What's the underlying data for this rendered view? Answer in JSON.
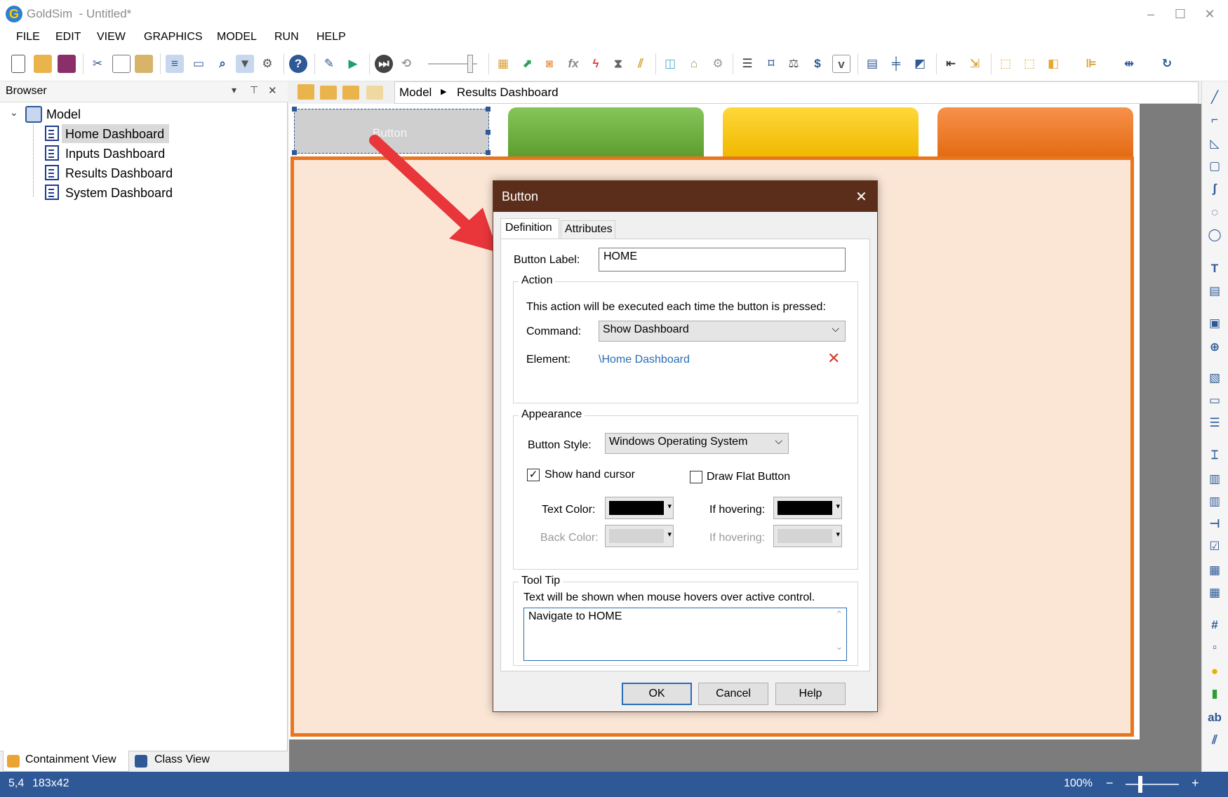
{
  "window": {
    "title": "GoldSim  - Untitled*",
    "logo": "G",
    "minimize": "–",
    "maximize": "☐",
    "close": "✕"
  },
  "menu": [
    "FILE",
    "EDIT",
    "VIEW",
    "GRAPHICS",
    "MODEL",
    "RUN",
    "HELP"
  ],
  "browser": {
    "title": "Browser",
    "root": "Model",
    "items": [
      "Home Dashboard",
      "Inputs Dashboard",
      "Results Dashboard",
      "System Dashboard"
    ],
    "tabs": [
      "Containment View",
      "Class View"
    ]
  },
  "breadcrumb": {
    "root": "Model",
    "current": "Results Dashboard"
  },
  "canvas": {
    "button_text": "Button",
    "colors": {
      "green": "#6aaa3a",
      "yellow": "#f5c000",
      "orange": "#ef7a1a",
      "panel_fill": "#fbe6d6",
      "panel_border": "#e8761e"
    }
  },
  "dialog": {
    "title": "Button",
    "tabs": [
      "Definition",
      "Attributes"
    ],
    "button_label": {
      "label": "Button Label:",
      "value": "HOME"
    },
    "action": {
      "title": "Action",
      "description": "This action will be executed each time the button is pressed:",
      "command_label": "Command:",
      "command_value": "Show Dashboard",
      "element_label": "Element:",
      "element_value": "\\Home Dashboard",
      "remove_icon": "✕"
    },
    "appearance": {
      "title": "Appearance",
      "style_label": "Button Style:",
      "style_value": "Windows Operating System",
      "hand_cursor_label": "Show hand cursor",
      "hand_cursor_checked": true,
      "flat_label": "Draw Flat Button",
      "flat_checked": false,
      "text_color_label": "Text Color:",
      "text_hover_label": "If hovering:",
      "back_color_label": "Back Color:",
      "back_hover_label": "If hovering:",
      "text_color": "#000000",
      "back_color": "#d4d4d4"
    },
    "tooltip": {
      "title": "Tool Tip",
      "description": "Text will be shown when mouse hovers over active control.",
      "value": "Navigate to HOME"
    },
    "buttons": {
      "ok": "OK",
      "cancel": "Cancel",
      "help": "Help"
    }
  },
  "status": {
    "position": "5,4",
    "size": "183x42",
    "zoom": "100%",
    "zoom_minus": "−",
    "zoom_plus": "+"
  },
  "icons": {
    "check": "✓",
    "chevron_down": "⌵",
    "tree_expand": "⌄",
    "breadcrumb_arrow": "▶",
    "pin": "⊤",
    "close": "✕",
    "dropdown": "▾",
    "scroll_up": "⌃",
    "scroll_down": "⌄"
  }
}
